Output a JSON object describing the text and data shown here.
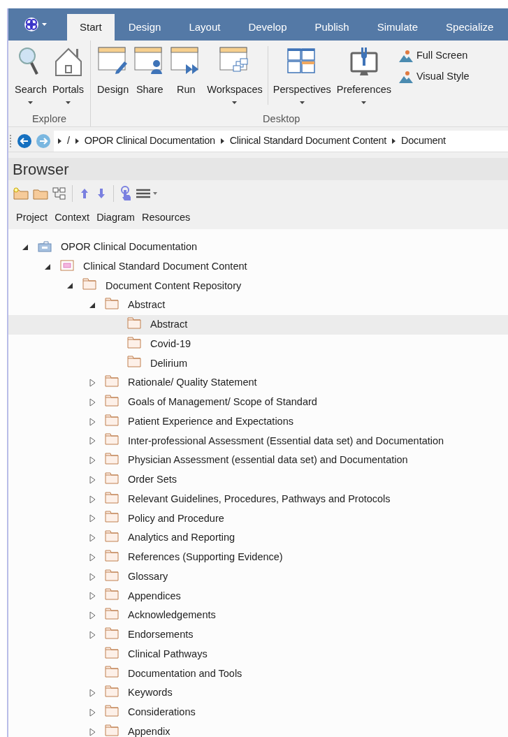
{
  "ribbon_tabs": [
    {
      "label": "Start",
      "selected": true
    },
    {
      "label": "Design",
      "selected": false
    },
    {
      "label": "Layout",
      "selected": false
    },
    {
      "label": "Develop",
      "selected": false
    },
    {
      "label": "Publish",
      "selected": false
    },
    {
      "label": "Simulate",
      "selected": false
    },
    {
      "label": "Specialize",
      "selected": false
    }
  ],
  "ribbon_groups": [
    {
      "label": "Explore",
      "buttons": [
        {
          "label": "Search",
          "kind": "search",
          "dropdown": true
        },
        {
          "label": "Portals",
          "kind": "house",
          "dropdown": true
        }
      ]
    },
    {
      "label": "Desktop",
      "buttons": [
        {
          "label": "Design",
          "kind": "pencil",
          "dropdown": false
        },
        {
          "label": "Share",
          "kind": "person",
          "dropdown": false
        },
        {
          "label": "Run",
          "kind": "run",
          "dropdown": false
        },
        {
          "label": "Workspaces",
          "kind": "workspaces",
          "dropdown": true
        },
        {
          "label": "Perspectives",
          "kind": "grid",
          "dropdown": true
        },
        {
          "label": "Preferences",
          "kind": "monitor",
          "dropdown": true
        }
      ],
      "small_buttons": [
        {
          "label": "Full Screen"
        },
        {
          "label": "Visual Style"
        }
      ]
    }
  ],
  "breadcrumb": [
    "/",
    "OPOR Clinical Documentation",
    "Clinical Standard Document Content",
    "Document"
  ],
  "browser": {
    "title": "Browser",
    "view_tabs": [
      "Project",
      "Context",
      "Diagram",
      "Resources"
    ],
    "tree": [
      {
        "label": "OPOR Clinical Documentation",
        "kind": "model",
        "expanded": true,
        "selected": false,
        "children": [
          {
            "label": "Clinical Standard Document Content",
            "kind": "view",
            "expanded": true,
            "selected": false,
            "children": [
              {
                "label": "Document Content Repository",
                "kind": "folder",
                "expanded": true,
                "selected": false,
                "children": [
                  {
                    "label": "Abstract",
                    "kind": "folder",
                    "expanded": true,
                    "selected": false,
                    "children": [
                      {
                        "label": "Abstract",
                        "kind": "folder",
                        "selected": true
                      },
                      {
                        "label": "Covid-19",
                        "kind": "folder",
                        "selected": false
                      },
                      {
                        "label": "Delirium",
                        "kind": "folder",
                        "selected": false
                      }
                    ]
                  },
                  {
                    "label": "Rationale/ Quality Statement",
                    "kind": "folder",
                    "expanded": false,
                    "selected": false
                  },
                  {
                    "label": "Goals of Management/ Scope of Standard",
                    "kind": "folder",
                    "expanded": false,
                    "selected": false
                  },
                  {
                    "label": "Patient Experience and Expectations",
                    "kind": "folder",
                    "expanded": false,
                    "selected": false
                  },
                  {
                    "label": "Inter-professional Assessment (Essential data set) and Documentation",
                    "kind": "folder",
                    "expanded": false,
                    "selected": false
                  },
                  {
                    "label": "Physician Assessment (essential data set) and Documentation",
                    "kind": "folder",
                    "expanded": false,
                    "selected": false
                  },
                  {
                    "label": "Order Sets",
                    "kind": "folder",
                    "expanded": false,
                    "selected": false
                  },
                  {
                    "label": "Relevant Guidelines, Procedures, Pathways and Protocols",
                    "kind": "folder",
                    "expanded": false,
                    "selected": false
                  },
                  {
                    "label": "Policy and Procedure",
                    "kind": "folder",
                    "expanded": false,
                    "selected": false
                  },
                  {
                    "label": "Analytics and Reporting",
                    "kind": "folder",
                    "expanded": false,
                    "selected": false
                  },
                  {
                    "label": "References (Supporting Evidence)",
                    "kind": "folder",
                    "expanded": false,
                    "selected": false
                  },
                  {
                    "label": "Glossary",
                    "kind": "folder",
                    "expanded": false,
                    "selected": false
                  },
                  {
                    "label": "Appendices",
                    "kind": "folder",
                    "expanded": false,
                    "selected": false
                  },
                  {
                    "label": "Acknowledgements",
                    "kind": "folder",
                    "expanded": false,
                    "selected": false
                  },
                  {
                    "label": "Endorsements",
                    "kind": "folder",
                    "expanded": false,
                    "selected": false
                  },
                  {
                    "label": "Clinical Pathways",
                    "kind": "folder",
                    "selected": false
                  },
                  {
                    "label": "Documentation and Tools",
                    "kind": "folder",
                    "selected": false
                  },
                  {
                    "label": "Keywords",
                    "kind": "folder",
                    "expanded": false,
                    "selected": false
                  },
                  {
                    "label": "Considerations",
                    "kind": "folder",
                    "expanded": false,
                    "selected": false
                  },
                  {
                    "label": "Appendix",
                    "kind": "folder",
                    "expanded": false,
                    "selected": false
                  }
                ]
              }
            ]
          }
        ]
      }
    ]
  }
}
